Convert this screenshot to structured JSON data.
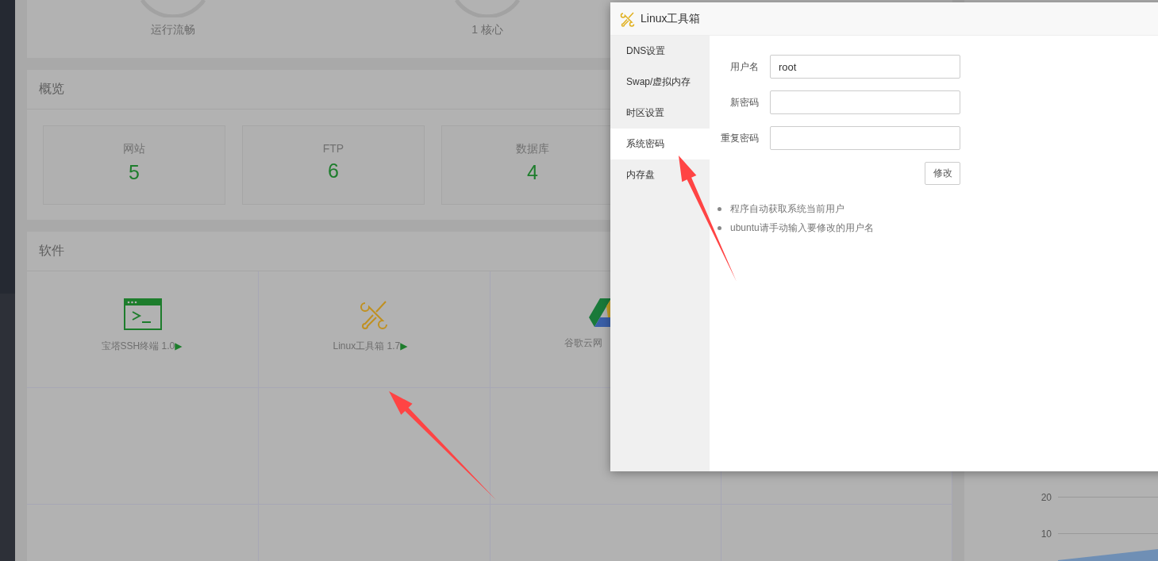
{
  "top_stats": [
    {
      "label": "运行流畅"
    },
    {
      "label": "1 核心"
    }
  ],
  "overview": {
    "title": "概览",
    "cards": [
      {
        "label": "网站",
        "value": "5"
      },
      {
        "label": "FTP",
        "value": "6"
      },
      {
        "label": "数据库",
        "value": "4"
      }
    ]
  },
  "software": {
    "title": "软件",
    "items": [
      {
        "name": "宝塔SSH终端 1.0",
        "marker": "▶",
        "kind": "terminal"
      },
      {
        "name": "Linux工具箱 1.7",
        "marker": "▶",
        "kind": "tools"
      },
      {
        "name": "谷歌云网",
        "kind": "drive"
      }
    ]
  },
  "chart": {
    "y_labels": [
      "20",
      "10"
    ]
  },
  "dialog": {
    "title": "Linux工具箱",
    "menu": [
      {
        "label": "DNS设置",
        "selected": false
      },
      {
        "label": "Swap/虚拟内存",
        "selected": false
      },
      {
        "label": "时区设置",
        "selected": false
      },
      {
        "label": "系统密码",
        "selected": true
      },
      {
        "label": "内存盘",
        "selected": false
      }
    ],
    "fields": [
      {
        "label": "用户名",
        "value": "root"
      },
      {
        "label": "新密码"
      },
      {
        "label": "重复密码"
      }
    ],
    "submit": "修改",
    "notes": [
      "程序自动获取系统当前用户",
      "ubuntu请手动输入要修改的用户名"
    ]
  }
}
